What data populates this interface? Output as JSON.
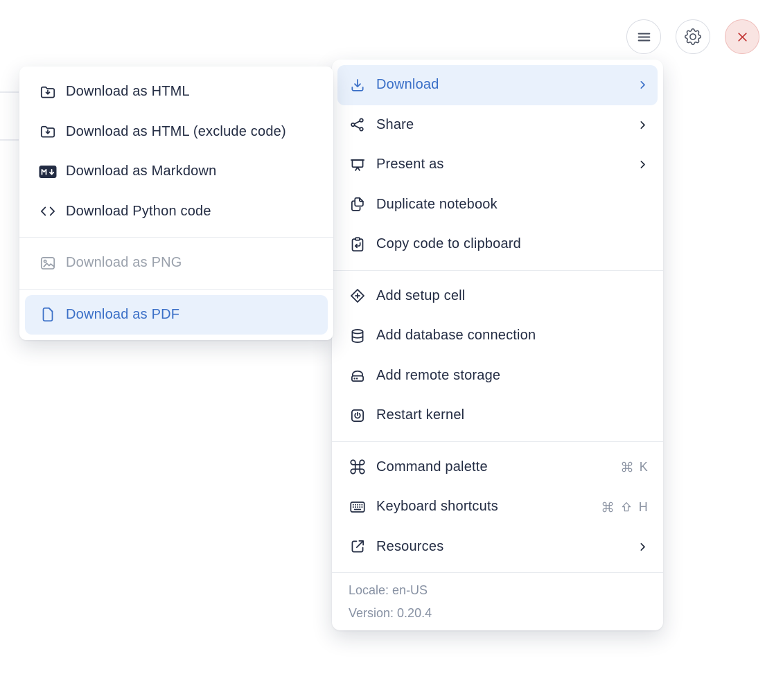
{
  "colors": {
    "accent_blue": "#3a6fc7",
    "highlight_bg": "#e9f1fc",
    "text_dark": "#232c43",
    "text_disabled": "#9aa1ac",
    "text_muted": "#8791a3",
    "danger_red": "#c43c3a",
    "danger_bg": "#f9e4e2",
    "divider": "#e8ebef"
  },
  "toolbar": {
    "buttons": [
      {
        "name": "menu",
        "icon": "hamburger-icon"
      },
      {
        "name": "settings",
        "icon": "gear-icon"
      },
      {
        "name": "close",
        "icon": "close-icon",
        "danger": true
      }
    ]
  },
  "submenu": {
    "groups": [
      {
        "items": [
          {
            "label": "Download as HTML",
            "icon": "folder-download-icon"
          },
          {
            "label": "Download as HTML (exclude code)",
            "icon": "folder-download-icon"
          },
          {
            "label": "Download as Markdown",
            "icon": "markdown-icon"
          },
          {
            "label": "Download Python code",
            "icon": "code-icon"
          }
        ]
      },
      {
        "items": [
          {
            "label": "Download as PNG",
            "icon": "image-icon",
            "disabled": true
          }
        ]
      },
      {
        "items": [
          {
            "label": "Download as PDF",
            "icon": "file-icon",
            "highlighted": true
          }
        ]
      }
    ]
  },
  "menu": {
    "groups": [
      {
        "items": [
          {
            "label": "Download",
            "icon": "download-icon",
            "highlighted": true,
            "submenu": true
          },
          {
            "label": "Share",
            "icon": "share-icon",
            "submenu": true
          },
          {
            "label": "Present as",
            "icon": "present-icon",
            "submenu": true
          },
          {
            "label": "Duplicate notebook",
            "icon": "duplicate-icon"
          },
          {
            "label": "Copy code to clipboard",
            "icon": "clipboard-icon"
          }
        ]
      },
      {
        "items": [
          {
            "label": "Add setup cell",
            "icon": "add-cell-icon"
          },
          {
            "label": "Add database connection",
            "icon": "database-icon"
          },
          {
            "label": "Add remote storage",
            "icon": "storage-icon"
          },
          {
            "label": "Restart kernel",
            "icon": "restart-icon"
          }
        ]
      },
      {
        "items": [
          {
            "label": "Command palette",
            "icon": "command-icon",
            "shortcut": [
              "cmd",
              "K"
            ]
          },
          {
            "label": "Keyboard shortcuts",
            "icon": "keyboard-icon",
            "shortcut": [
              "cmd",
              "shift",
              "H"
            ]
          },
          {
            "label": "Resources",
            "icon": "external-link-icon",
            "submenu": true
          }
        ]
      }
    ],
    "footer": {
      "locale": "Locale: en-US",
      "version": "Version: 0.20.4"
    }
  }
}
